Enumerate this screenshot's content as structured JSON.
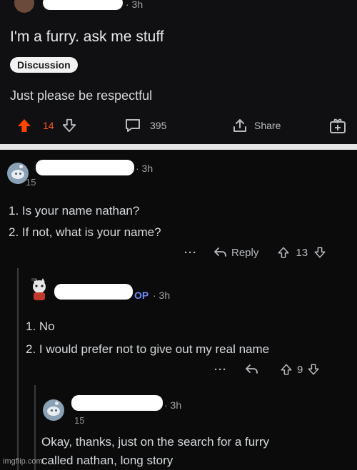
{
  "post": {
    "time": "· 3h",
    "title": "I'm a furry. ask me stuff",
    "flair": "Discussion",
    "body": "Just please be respectful",
    "upvotes": "14",
    "comments_count": "395",
    "share_label": "Share"
  },
  "comments": [
    {
      "time": "· 3h",
      "score_small": "15",
      "lines": [
        "1. Is your name nathan?",
        "2. If not, what is your name?"
      ],
      "more": "···",
      "reply_label": "Reply",
      "votes": "13"
    },
    {
      "op_tag": "OP",
      "time": "· 3h",
      "lines": [
        "1. No",
        "2. I would prefer not to give out my real name"
      ],
      "more": "···",
      "votes": "9"
    },
    {
      "time": "· 3h",
      "score_small": "15",
      "lines": [
        "Okay, thanks, just on the search for a furry",
        "called nathan, long story"
      ]
    }
  ],
  "watermark": "imgflip.com",
  "colors": {
    "upvote_active": "#ff4500",
    "op_blue": "#6d8cf5",
    "background": "#0b0b0c",
    "divider": "#e6e6e6"
  },
  "icons": [
    "upvote-icon",
    "downvote-icon",
    "comment-icon",
    "share-icon",
    "award-icon",
    "reply-icon",
    "more-icon"
  ]
}
